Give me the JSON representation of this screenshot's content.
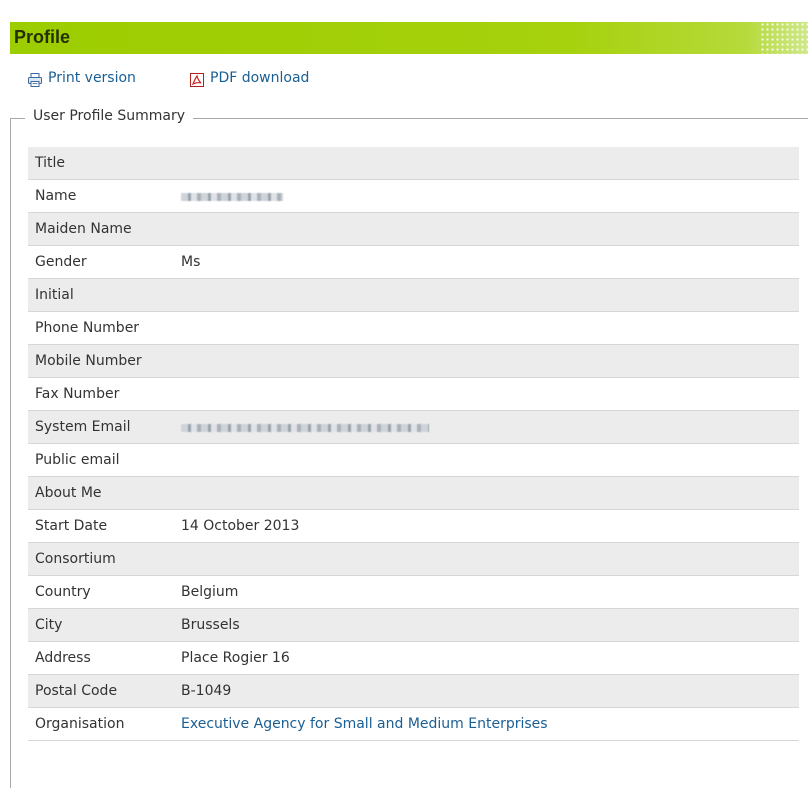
{
  "header": {
    "title": "Profile"
  },
  "actions": {
    "print_label": "Print version",
    "pdf_label": "PDF download",
    "print_icon": "printer-icon",
    "pdf_icon": "pdf-icon"
  },
  "summary": {
    "legend": "User Profile Summary",
    "rows": [
      {
        "label": "Title",
        "value": ""
      },
      {
        "label": "Name",
        "value": ""
      },
      {
        "label": "Maiden Name",
        "value": ""
      },
      {
        "label": "Gender",
        "value": "Ms"
      },
      {
        "label": "Initial",
        "value": ""
      },
      {
        "label": "Phone Number",
        "value": ""
      },
      {
        "label": "Mobile Number",
        "value": ""
      },
      {
        "label": "Fax Number",
        "value": ""
      },
      {
        "label": "System Email",
        "value": ""
      },
      {
        "label": "Public email",
        "value": ""
      },
      {
        "label": "About Me",
        "value": ""
      },
      {
        "label": "Start Date",
        "value": "14 October 2013"
      },
      {
        "label": "Consortium",
        "value": ""
      },
      {
        "label": "Country",
        "value": "Belgium"
      },
      {
        "label": "City",
        "value": "Brussels"
      },
      {
        "label": "Address",
        "value": "Place Rogier 16"
      },
      {
        "label": "Postal Code",
        "value": "B-1049"
      },
      {
        "label": "Organisation",
        "value": "Executive Agency for Small and Medium Enterprises"
      }
    ]
  },
  "colors": {
    "header_green": "#9ccd00",
    "link_blue": "#1a5f94",
    "row_shade": "#ececec"
  }
}
